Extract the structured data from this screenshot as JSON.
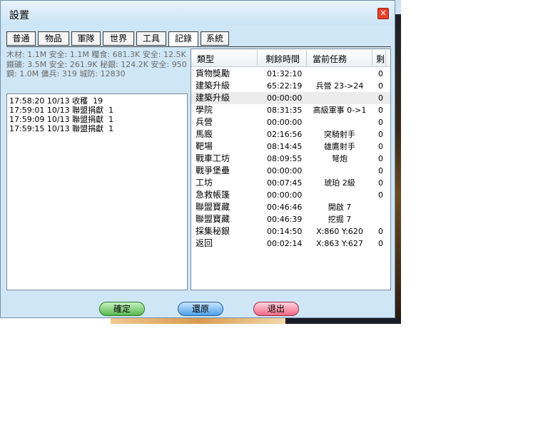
{
  "window": {
    "title": "設置",
    "close_symbol": "✕"
  },
  "tabs": [
    {
      "label": "普通"
    },
    {
      "label": "物品"
    },
    {
      "label": "軍隊"
    },
    {
      "label": "世界"
    },
    {
      "label": "工具"
    },
    {
      "label": "記錄",
      "active": true
    },
    {
      "label": "系統"
    }
  ],
  "resources": {
    "line1": "木材: 1.1M 安全: 1.1M  糧食: 681.3K 安全: 12.5K",
    "line2": "鐵礦: 3.5M 安全: 261.9K  秘銀: 124.2K 安全: 950",
    "line3": " 鋼: 1.0M  傭兵: 319  城防: 12830"
  },
  "log": [
    "17:58:20 10/13 收穫  19",
    "17:59:01 10/13 聯盟捐獻  1",
    "17:59:09 10/13 聯盟捐獻  1",
    "17:59:15 10/13 聯盟捐獻  1"
  ],
  "table": {
    "headers": {
      "type": "類型",
      "time": "剩餘時間",
      "task": "當前任務",
      "num": "剩"
    },
    "rows": [
      {
        "type": "貨物獎勵",
        "time": "01:32:10",
        "task": "",
        "num": "0"
      },
      {
        "type": "建築升級",
        "time": "65:22:19",
        "task": "兵營 23->24",
        "num": "0"
      },
      {
        "type": "建築升級",
        "time": "00:00:00",
        "task": "",
        "num": "0",
        "selected": true
      },
      {
        "type": "學院",
        "time": "08:31:35",
        "task": "高級軍事 0->1",
        "num": "0"
      },
      {
        "type": "兵營",
        "time": "00:00:00",
        "task": "",
        "num": "0"
      },
      {
        "type": "馬廄",
        "time": "02:16:56",
        "task": "突騎射手",
        "num": "0"
      },
      {
        "type": "靶場",
        "time": "08:14:45",
        "task": "雄鷹射手",
        "num": "0"
      },
      {
        "type": "戰車工坊",
        "time": "08:09:55",
        "task": "弩炮",
        "num": "0"
      },
      {
        "type": "戰爭堡壘",
        "time": "00:00:00",
        "task": "",
        "num": "0"
      },
      {
        "type": "工坊",
        "time": "00:07:45",
        "task": "琥珀 2級",
        "num": "0"
      },
      {
        "type": "急救帳篷",
        "time": "00:00:00",
        "task": "",
        "num": "0"
      },
      {
        "type": "聯盟寶藏",
        "time": "00:46:46",
        "task": "開啟 7",
        "num": ""
      },
      {
        "type": "聯盟寶藏",
        "time": "00:46:39",
        "task": "挖掘 7",
        "num": ""
      },
      {
        "type": "採集秘銀",
        "time": "00:14:50",
        "task": "X:860 Y:620",
        "num": "0"
      },
      {
        "type": "返回",
        "time": "00:02:14",
        "task": "X:863 Y:627",
        "num": "0"
      }
    ]
  },
  "buttons": {
    "ok": "確定",
    "reset": "還原",
    "exit": "退出"
  }
}
